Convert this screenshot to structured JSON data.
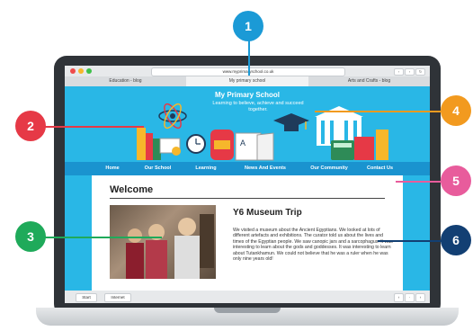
{
  "browser": {
    "url": "www.myprimaryschool.co.uk",
    "tabs": [
      "Education - blog",
      "My primary school",
      "Arts and Crafts - blog"
    ]
  },
  "site": {
    "title": "My Primary School",
    "tagline": "Learning to believe, achieve and succeed together."
  },
  "nav": [
    "Home",
    "Our School",
    "Learning",
    "News And Events",
    "Our Community",
    "Contact Us"
  ],
  "main": {
    "heading": "Welcome",
    "article_title": "Y6 Museum Trip",
    "article_body": "We visited a museum about the Ancient Egyptians. We looked at lots of different artefacts and exhibitions. The curator told us about the lives and times of the Egyptian people. We saw canopic jars and a sarcophagus. It was interesting to learn about the gods and goddesses. It was interesting to learn about Tutankhamun. We could not believe that he was a ruler when he was only nine years old!"
  },
  "statusbar": {
    "start_label": "Start",
    "internet_label": "Internet"
  },
  "callouts": [
    {
      "number": "1",
      "color": "#1b9ad6"
    },
    {
      "number": "2",
      "color": "#e63946"
    },
    {
      "number": "3",
      "color": "#1faa5a"
    },
    {
      "number": "4",
      "color": "#f29a1f"
    },
    {
      "number": "5",
      "color": "#e85c9c"
    },
    {
      "number": "6",
      "color": "#123f73"
    }
  ],
  "icons": [
    "atom-icon",
    "books-icon",
    "certificate-icon",
    "alarm-clock-icon",
    "backpack-icon",
    "open-book-icon",
    "graduation-cap-icon",
    "school-building-icon",
    "calculator-icon",
    "notebook-icon"
  ]
}
